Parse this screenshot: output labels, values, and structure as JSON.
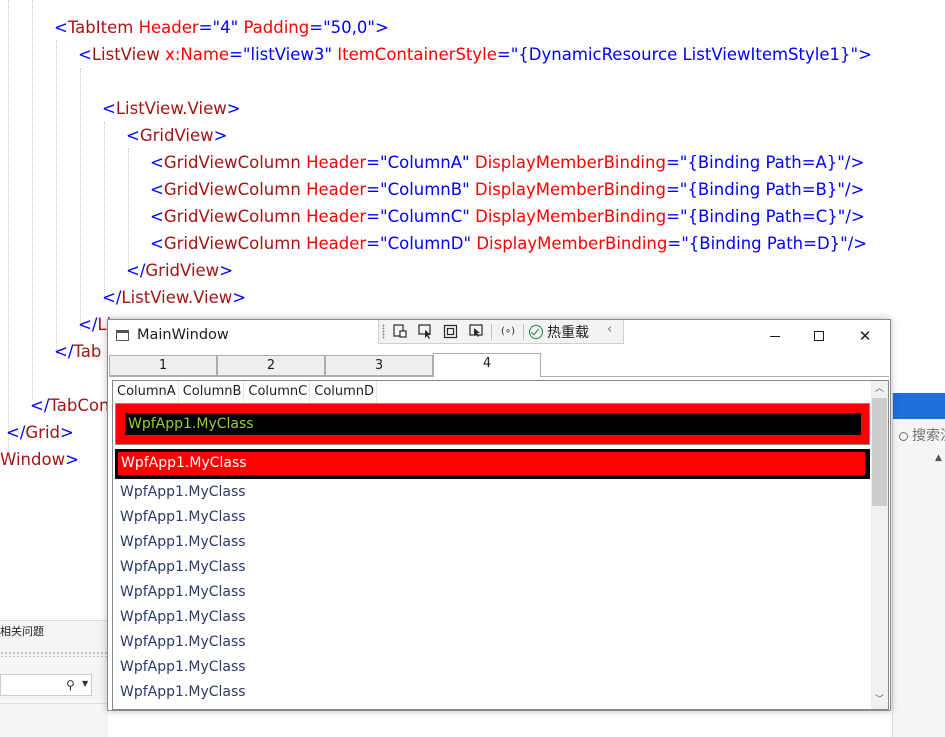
{
  "editor": {
    "lines": [
      "<TabItem Header=\"4\" Padding=\"50,0\">",
      "<ListView x:Name=\"listView3\" ItemContainerStyle=\"{DynamicResource ListViewItemStyle1}\">",
      "<ListView.View>",
      "<GridView>",
      "<GridViewColumn Header=\"ColumnA\" DisplayMemberBinding=\"{Binding Path=A}\"/>",
      "<GridViewColumn Header=\"ColumnB\" DisplayMemberBinding=\"{Binding Path=B}\"/>",
      "<GridViewColumn Header=\"ColumnC\" DisplayMemberBinding=\"{Binding Path=C}\"/>",
      "<GridViewColumn Header=\"ColumnD\" DisplayMemberBinding=\"{Binding Path=D}\"/>",
      "</GridView>",
      "</ListView.View>",
      "</Li",
      "</Tab",
      "</TabCon",
      "</Grid>",
      "Window>"
    ]
  },
  "side_panel": {
    "search_placeholder": "搜索洪",
    "search_icon": "search-icon"
  },
  "bottom_panel": {
    "tab_label": "相关问题",
    "search_icon": "search-icon",
    "dropdown_icon": "chevron-down-icon"
  },
  "window": {
    "title": "MainWindow",
    "minimize_icon": "minimize-icon",
    "maximize_icon": "maximize-icon",
    "close_label": "✕"
  },
  "runtime_toolbar": {
    "hot_reload_label": "热重载",
    "collapse_label": "‹"
  },
  "tabs": [
    {
      "label": "1"
    },
    {
      "label": "2"
    },
    {
      "label": "3"
    },
    {
      "label": "4",
      "active": true
    }
  ],
  "listview": {
    "columns": [
      "ColumnA",
      "ColumnB",
      "ColumnC",
      "ColumnD"
    ],
    "selected_item": "WpfApp1.MyClass",
    "focused_item": "WpfApp1.MyClass",
    "items": [
      "WpfApp1.MyClass",
      "WpfApp1.MyClass",
      "WpfApp1.MyClass",
      "WpfApp1.MyClass",
      "WpfApp1.MyClass",
      "WpfApp1.MyClass",
      "WpfApp1.MyClass",
      "WpfApp1.MyClass",
      "WpfApp1.MyClass"
    ]
  },
  "colors": {
    "xaml_punct": "#0000ff",
    "xaml_tag": "#a31515",
    "xaml_attr": "#ff0000",
    "xaml_value": "#0000ff",
    "selected_bg": "#ff0000",
    "selected_inner_bg": "#000000",
    "selected_text": "#9acd32",
    "focus_bg": "#000000",
    "focus_inner_bg": "#ff0000",
    "item_text": "#2a3a6a"
  }
}
